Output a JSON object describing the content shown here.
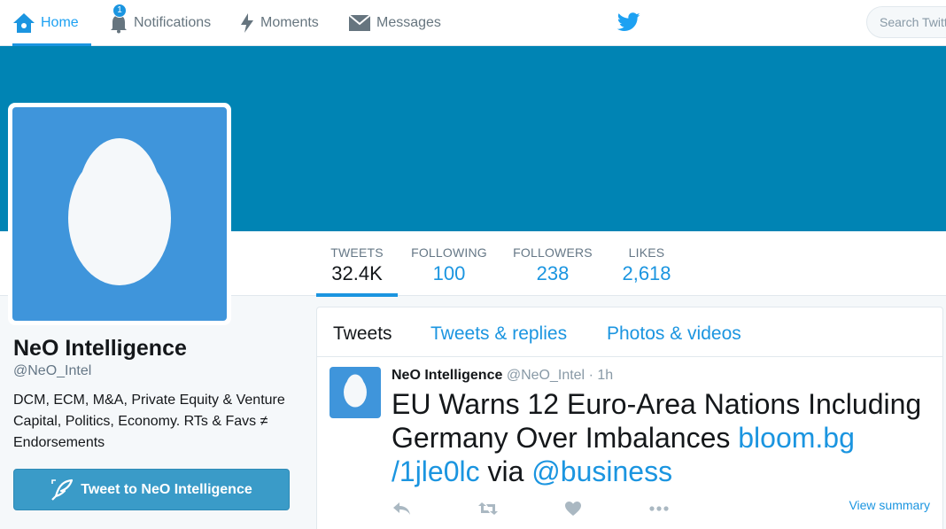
{
  "nav": {
    "home_label": "Home",
    "notifications_label": "Notifications",
    "notifications_badge": "1",
    "moments_label": "Moments",
    "messages_label": "Messages",
    "search_placeholder": "Search Twitter"
  },
  "colors": {
    "banner": "#0084b4",
    "accent": "#1b95e0",
    "avatar_bg": "#3f95db",
    "tweet_to_button": "#3a9bc8"
  },
  "stats": [
    {
      "label": "TWEETS",
      "value": "32.4K"
    },
    {
      "label": "FOLLOWING",
      "value": "100"
    },
    {
      "label": "FOLLOWERS",
      "value": "238"
    },
    {
      "label": "LIKES",
      "value": "2,618"
    }
  ],
  "profile": {
    "name": "NeO Intelligence",
    "handle": "@NeO_Intel",
    "bio": "DCM, ECM, M&A, Private Equity & Venture Capital, Politics, Economy. RTs & Favs ≠ Endorsements",
    "tweet_to_label": "Tweet to NeO Intelligence"
  },
  "timeline": {
    "tabs": [
      "Tweets",
      "Tweets & replies",
      "Photos & videos"
    ],
    "tweet": {
      "name": "NeO Intelligence",
      "handle": "@NeO_Intel",
      "separator": "·",
      "time": "1h",
      "text": "EU Warns 12 Euro-Area Nations Including Germany Over Imbalances ",
      "link": "bloom.bg /1jle0lc",
      "via": " via ",
      "mention": "@business",
      "view_summary": "View summary"
    }
  },
  "icons": [
    "home-icon",
    "bell-icon",
    "lightning-icon",
    "envelope-icon",
    "twitter-bird-icon",
    "egg-icon",
    "quill-icon",
    "reply-icon",
    "retweet-icon",
    "heart-icon",
    "more-icon"
  ]
}
